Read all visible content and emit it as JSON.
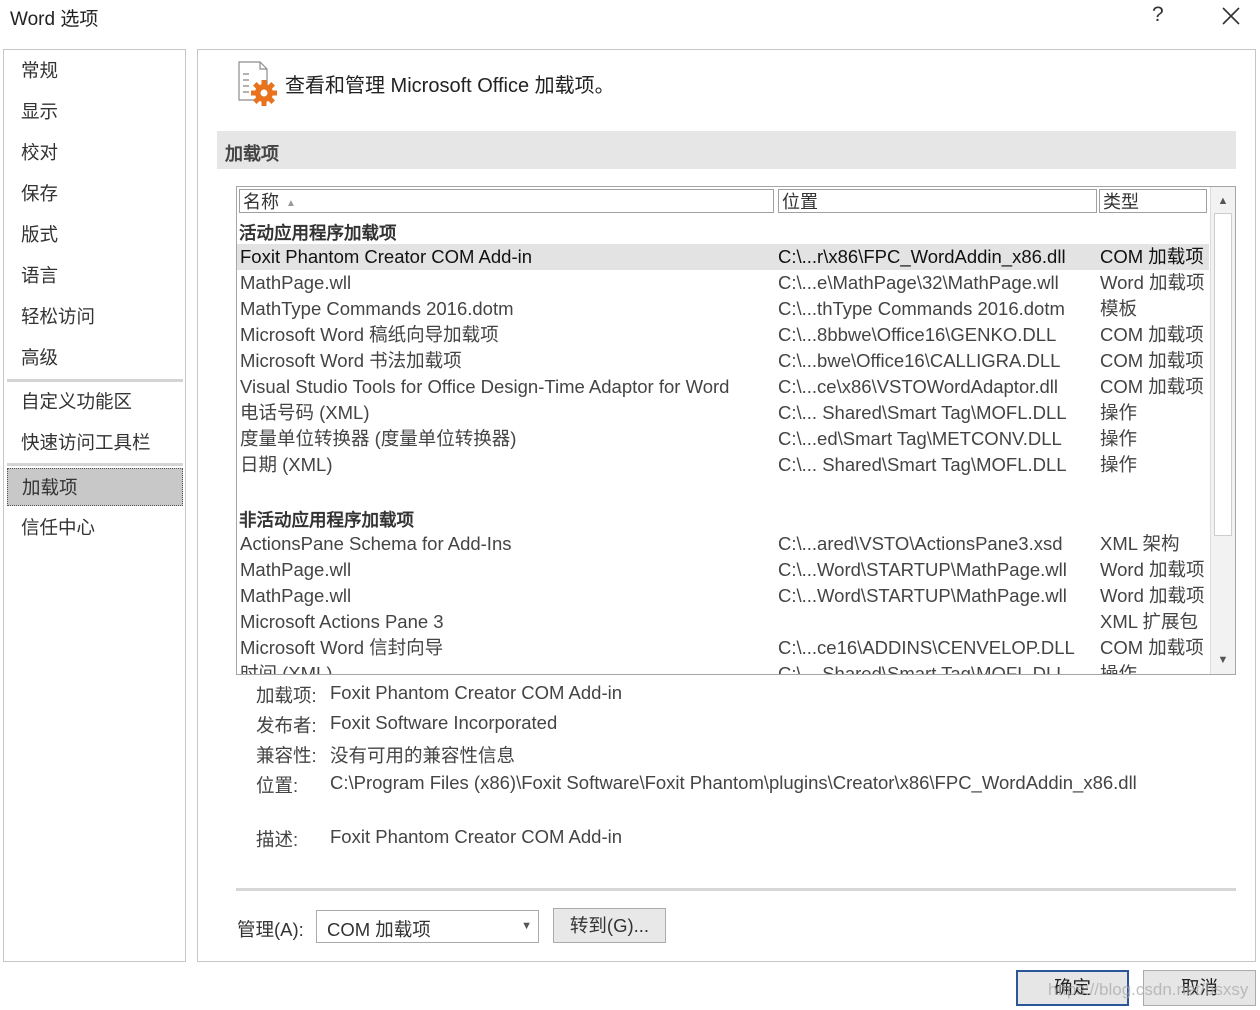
{
  "window": {
    "title": "Word 选项",
    "help_label": "?",
    "close_icon": "close-icon"
  },
  "nav": {
    "items": [
      "常规",
      "显示",
      "校对",
      "保存",
      "版式",
      "语言",
      "轻松访问",
      "高级",
      "自定义功能区",
      "快速访问工具栏",
      "加载项",
      "信任中心"
    ],
    "selected": "加载项"
  },
  "header": {
    "text": "查看和管理 Microsoft Office 加载项。",
    "icon": "addins-gear-icon"
  },
  "section": {
    "title": "加载项"
  },
  "addin_list": {
    "columns": {
      "name": "名称",
      "name_sort_indicator": "▲",
      "location": "位置",
      "type": "类型"
    },
    "active_group": "活动应用程序加载项",
    "active_rows": [
      {
        "name": "Foxit Phantom Creator COM Add-in",
        "location": "C:\\...r\\x86\\FPC_WordAddin_x86.dll",
        "type": "COM 加载项",
        "selected": true
      },
      {
        "name": "MathPage.wll",
        "location": "C:\\...e\\MathPage\\32\\MathPage.wll",
        "type": "Word 加载项"
      },
      {
        "name": "MathType Commands 2016.dotm",
        "location": "C:\\...thType Commands 2016.dotm",
        "type": "模板"
      },
      {
        "name": "Microsoft Word 稿纸向导加载项",
        "location": "C:\\...8bbwe\\Office16\\GENKO.DLL",
        "type": "COM 加载项"
      },
      {
        "name": "Microsoft Word 书法加载项",
        "location": "C:\\...bwe\\Office16\\CALLIGRA.DLL",
        "type": "COM 加载项"
      },
      {
        "name": "Visual Studio Tools for Office Design-Time Adaptor for Word",
        "location": "C:\\...ce\\x86\\VSTOWordAdaptor.dll",
        "type": "COM 加载项"
      },
      {
        "name": "电话号码 (XML)",
        "location": "C:\\... Shared\\Smart Tag\\MOFL.DLL",
        "type": "操作"
      },
      {
        "name": "度量单位转换器 (度量单位转换器)",
        "location": "C:\\...ed\\Smart Tag\\METCONV.DLL",
        "type": "操作"
      },
      {
        "name": "日期 (XML)",
        "location": "C:\\... Shared\\Smart Tag\\MOFL.DLL",
        "type": "操作"
      }
    ],
    "inactive_group": "非活动应用程序加载项",
    "inactive_rows": [
      {
        "name": "ActionsPane Schema for Add-Ins",
        "location": "C:\\...ared\\VSTO\\ActionsPane3.xsd",
        "type": "XML 架构"
      },
      {
        "name": "MathPage.wll",
        "location": "C:\\...Word\\STARTUP\\MathPage.wll",
        "type": "Word 加载项"
      },
      {
        "name": "MathPage.wll",
        "location": "C:\\...Word\\STARTUP\\MathPage.wll",
        "type": "Word 加载项"
      },
      {
        "name": "Microsoft Actions Pane 3",
        "location": "",
        "type": "XML 扩展包"
      },
      {
        "name": "Microsoft Word 信封向导",
        "location": "C:\\...ce16\\ADDINS\\CENVELOP.DLL",
        "type": "COM 加载项"
      },
      {
        "name": "时间 (XML)",
        "location": "C:\\... Shared\\Smart Tag\\MOFL.DLL",
        "type": "操作"
      }
    ]
  },
  "details": {
    "addin_label": "加载项:",
    "addin_value": "Foxit Phantom Creator COM Add-in",
    "publisher_label": "发布者:",
    "publisher_value": "Foxit Software Incorporated",
    "compat_label": "兼容性:",
    "compat_value": "没有可用的兼容性信息",
    "location_label": "位置:",
    "location_value": "C:\\Program Files (x86)\\Foxit Software\\Foxit Phantom\\plugins\\Creator\\x86\\FPC_WordAddin_x86.dll",
    "desc_label": "描述:",
    "desc_value": "Foxit Phantom Creator COM Add-in"
  },
  "manage": {
    "label": "管理(A):",
    "value": "COM 加载项",
    "go_label": "转到(G)..."
  },
  "footer": {
    "ok_label": "确定",
    "cancel_label": "取消",
    "watermark": "https://blog.csdn.net/bsxsy"
  }
}
